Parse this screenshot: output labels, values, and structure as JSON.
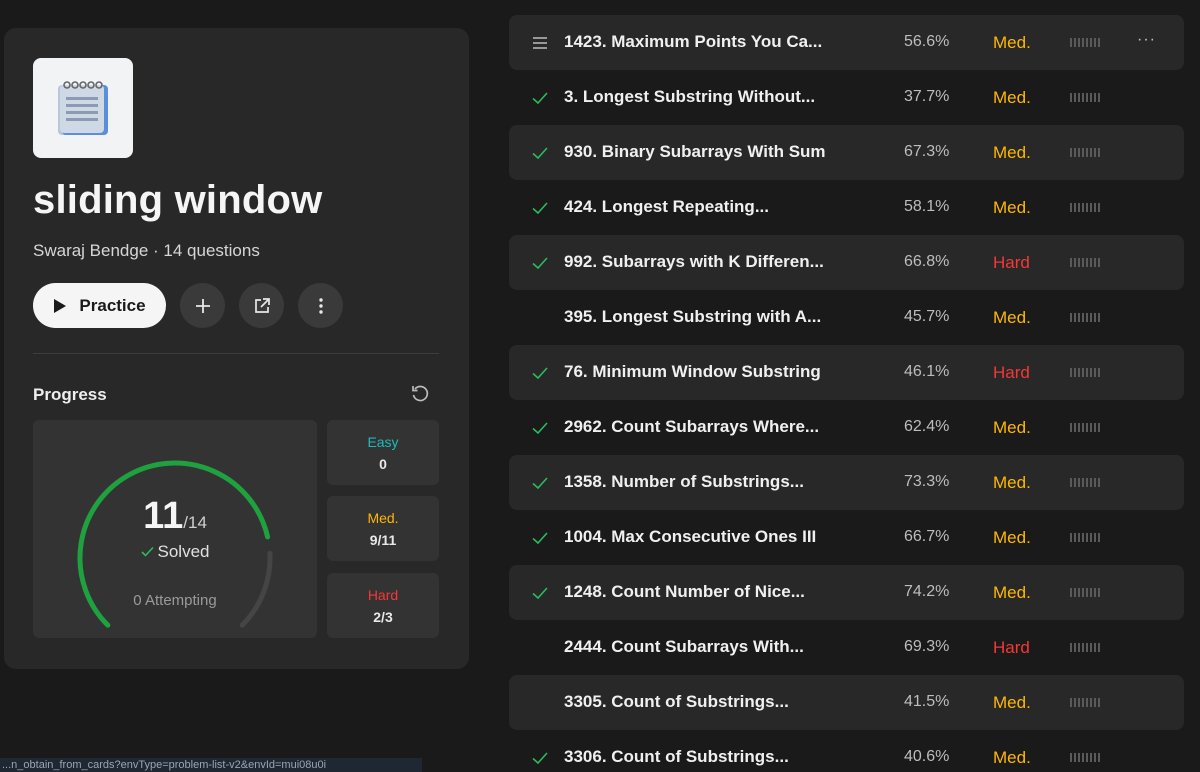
{
  "colors": {
    "easy": "#1cbaba",
    "medium": "#ffb700",
    "hard": "#f63737",
    "check": "#2cbb5d",
    "ring": "#1ea13e"
  },
  "list_header": {
    "title": "sliding window",
    "author": "Swaraj Bendge",
    "separator": " · ",
    "question_count": "14 questions",
    "practice_label": "Practice"
  },
  "progress": {
    "label": "Progress",
    "solved": "11",
    "total": "/14",
    "solved_label": "Solved",
    "solved_fraction": 0.7857,
    "attempting": "0 Attempting",
    "easy_label": "Easy",
    "easy_value": "0",
    "medium_label": "Med.",
    "medium_value": "9/11",
    "hard_label": "Hard",
    "hard_value": "2/3"
  },
  "questions": [
    {
      "title": "1423. Maximum Points You Ca...",
      "acceptance": "56.6%",
      "difficulty": "Med.",
      "lead": "menu-icon",
      "solved": false,
      "more": "···"
    },
    {
      "title": "3. Longest Substring Without...",
      "acceptance": "37.7%",
      "difficulty": "Med.",
      "lead": "check-icon",
      "solved": true
    },
    {
      "title": "930. Binary Subarrays With Sum",
      "acceptance": "67.3%",
      "difficulty": "Med.",
      "lead": "check-icon",
      "solved": true
    },
    {
      "title": "424. Longest Repeating...",
      "acceptance": "58.1%",
      "difficulty": "Med.",
      "lead": "check-icon",
      "solved": true
    },
    {
      "title": "992. Subarrays with K Differen...",
      "acceptance": "66.8%",
      "difficulty": "Hard",
      "lead": "check-icon",
      "solved": true
    },
    {
      "title": "395. Longest Substring with A...",
      "acceptance": "45.7%",
      "difficulty": "Med.",
      "lead": "none",
      "solved": false
    },
    {
      "title": "76. Minimum Window Substring",
      "acceptance": "46.1%",
      "difficulty": "Hard",
      "lead": "check-icon",
      "solved": true
    },
    {
      "title": "2962. Count Subarrays Where...",
      "acceptance": "62.4%",
      "difficulty": "Med.",
      "lead": "check-icon",
      "solved": true
    },
    {
      "title": "1358. Number of Substrings...",
      "acceptance": "73.3%",
      "difficulty": "Med.",
      "lead": "check-icon",
      "solved": true
    },
    {
      "title": "1004. Max Consecutive Ones III",
      "acceptance": "66.7%",
      "difficulty": "Med.",
      "lead": "check-icon",
      "solved": true
    },
    {
      "title": "1248. Count Number of Nice...",
      "acceptance": "74.2%",
      "difficulty": "Med.",
      "lead": "check-icon",
      "solved": true
    },
    {
      "title": "2444. Count Subarrays With...",
      "acceptance": "69.3%",
      "difficulty": "Hard",
      "lead": "none",
      "solved": false
    },
    {
      "title": "3305. Count of Substrings...",
      "acceptance": "41.5%",
      "difficulty": "Med.",
      "lead": "none",
      "solved": false
    },
    {
      "title": "3306. Count of Substrings...",
      "acceptance": "40.6%",
      "difficulty": "Med.",
      "lead": "check-icon",
      "solved": true
    }
  ],
  "status_bar": {
    "url": "...n_obtain_from_cards?envType=problem-list-v2&envId=mui08u0i"
  }
}
